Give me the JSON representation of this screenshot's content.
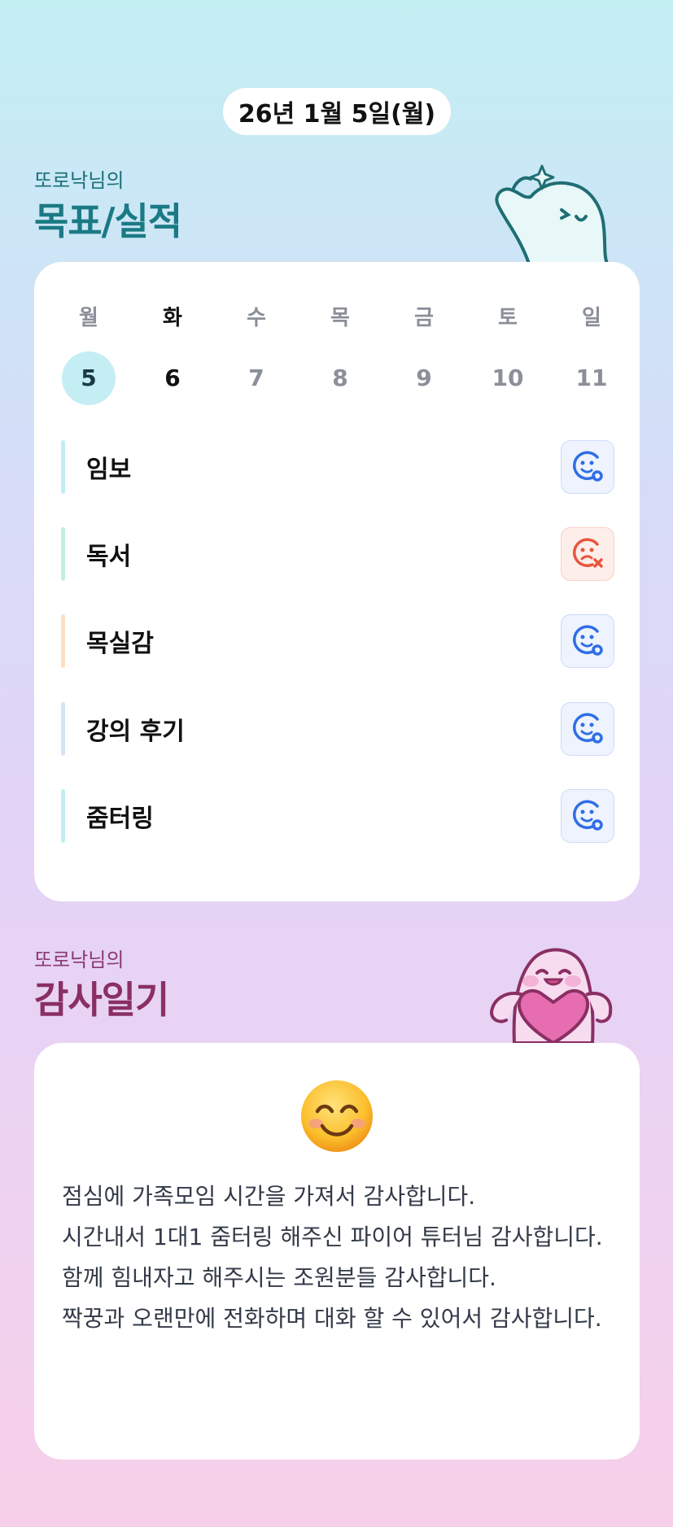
{
  "header": {
    "date": "26년 1월 5일(월)"
  },
  "goals_section": {
    "subtitle": "또로낙님의",
    "title": "목표/실적"
  },
  "calendar": {
    "weekdays": [
      "월",
      "화",
      "수",
      "목",
      "금",
      "토",
      "일"
    ],
    "days": [
      "5",
      "6",
      "7",
      "8",
      "9",
      "10",
      "11"
    ],
    "selected_index": 0
  },
  "goals": [
    {
      "label": "임보",
      "status": "done",
      "bar_color": "#c2eef3"
    },
    {
      "label": "독서",
      "status": "fail",
      "bar_color": "#c5efdd"
    },
    {
      "label": "목실감",
      "status": "done",
      "bar_color": "#fbe0c6"
    },
    {
      "label": "강의 후기",
      "status": "done",
      "bar_color": "#d6e2f7"
    },
    {
      "label": "줌터링",
      "status": "done",
      "bar_color": "#c2eef3"
    }
  ],
  "gratitude_section": {
    "subtitle": "또로낙님의",
    "title": "감사일기"
  },
  "gratitude": {
    "mood_icon": "smiling-face-emoji",
    "lines": [
      "점심에 가족모임 시간을 가져서 감사합니다.",
      "시간내서 1대1 줌터링 해주신 파이어 튜터님 감사합니다.",
      "함께 힘내자고 해주시는 조원분들 감사합니다.",
      "짝꿍과 오랜만에 전화하며 대화 할 수 있어서 감사합니다."
    ]
  },
  "colors": {
    "done_icon": "#2f6ee8",
    "fail_icon": "#e8553b",
    "goal_title": "#1a7a84",
    "gratitude_title": "#8a2f64"
  }
}
